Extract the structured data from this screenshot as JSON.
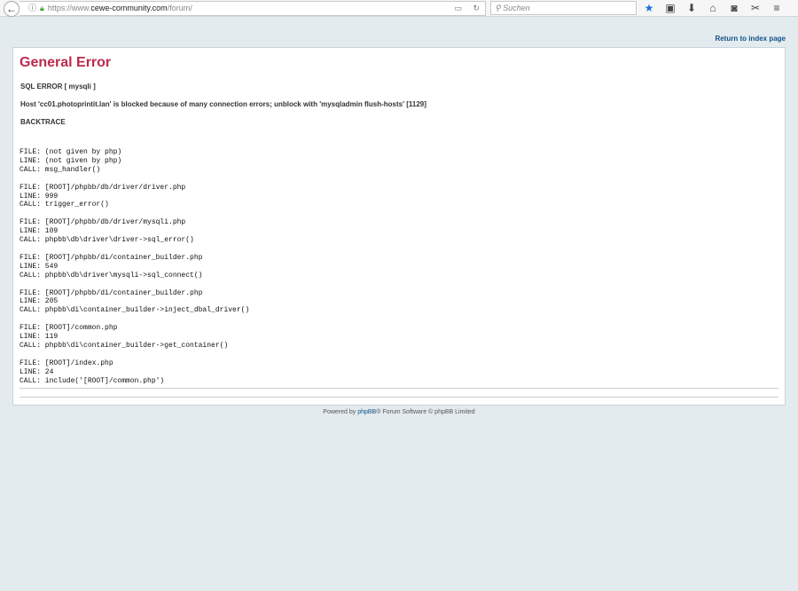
{
  "browser": {
    "url_prefix": "https://www.",
    "url_domain": "cewe-community.com",
    "url_path": "/forum/",
    "search_placeholder": "Suchen"
  },
  "nav": {
    "return_link": "Return to index page"
  },
  "error": {
    "title": "General Error",
    "sql_error": "SQL ERROR [ mysqli ]",
    "message": "Host 'cc01.photoprintit.lan' is blocked because of many connection errors; unblock with 'mysqladmin flush-hosts' [1129]",
    "backtrace_label": "BACKTRACE",
    "backtrace": "FILE: (not given by php)\nLINE: (not given by php)\nCALL: msg_handler()\n\nFILE: [ROOT]/phpbb/db/driver/driver.php\nLINE: 999\nCALL: trigger_error()\n\nFILE: [ROOT]/phpbb/db/driver/mysqli.php\nLINE: 109\nCALL: phpbb\\db\\driver\\driver->sql_error()\n\nFILE: [ROOT]/phpbb/di/container_builder.php\nLINE: 549\nCALL: phpbb\\db\\driver\\mysqli->sql_connect()\n\nFILE: [ROOT]/phpbb/di/container_builder.php\nLINE: 205\nCALL: phpbb\\di\\container_builder->inject_dbal_driver()\n\nFILE: [ROOT]/common.php\nLINE: 119\nCALL: phpbb\\di\\container_builder->get_container()\n\nFILE: [ROOT]/index.php\nLINE: 24\nCALL: include('[ROOT]/common.php')"
  },
  "footer": {
    "powered": "Powered by ",
    "link": "phpBB",
    "rest": "® Forum Software © phpBB Limited"
  }
}
